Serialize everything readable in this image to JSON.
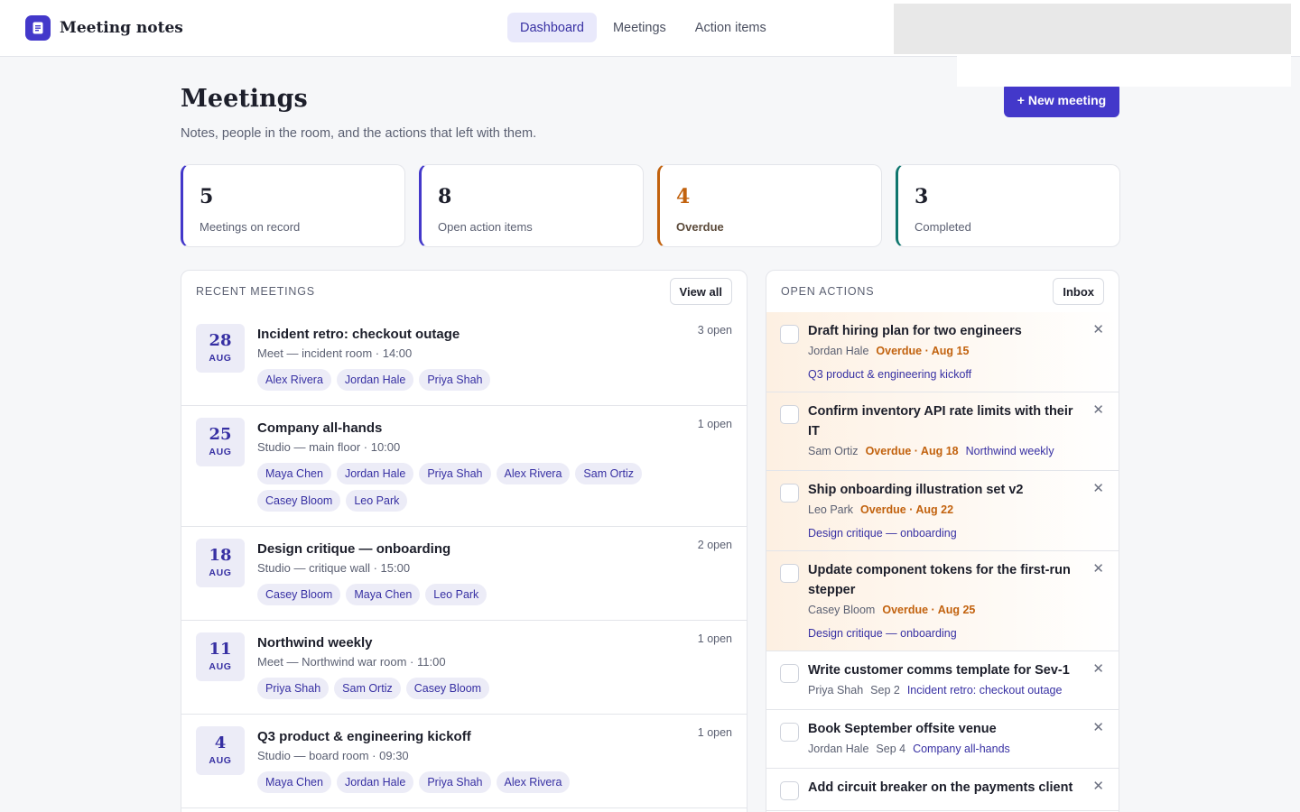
{
  "app": {
    "name": "Meeting notes"
  },
  "nav": {
    "tabs": [
      {
        "label": "Dashboard"
      },
      {
        "label": "Meetings"
      },
      {
        "label": "Action items"
      }
    ]
  },
  "header": {
    "title": "Meetings",
    "subtitle": "Notes, people in the room, and the actions that left with them.",
    "new_button": "+ New meeting"
  },
  "stats": [
    {
      "value": "5",
      "label": "Meetings on record"
    },
    {
      "value": "8",
      "label": "Open action items"
    },
    {
      "value": "4",
      "label": "Overdue"
    },
    {
      "value": "3",
      "label": "Completed"
    }
  ],
  "recent": {
    "title": "RECENT MEETINGS",
    "button": "View all",
    "meetings": [
      {
        "day": "28",
        "month": "AUG",
        "title": "Incident retro: checkout outage",
        "meta": "Meet — incident room · 14:00",
        "open": "3 open",
        "people": [
          "Alex Rivera",
          "Jordan Hale",
          "Priya Shah"
        ]
      },
      {
        "day": "25",
        "month": "AUG",
        "title": "Company all-hands",
        "meta": "Studio — main floor · 10:00",
        "open": "1 open",
        "people": [
          "Maya Chen",
          "Jordan Hale",
          "Priya Shah",
          "Alex Rivera",
          "Sam Ortiz",
          "Casey Bloom",
          "Leo Park"
        ]
      },
      {
        "day": "18",
        "month": "AUG",
        "title": "Design critique — onboarding",
        "meta": "Studio — critique wall · 15:00",
        "open": "2 open",
        "people": [
          "Casey Bloom",
          "Maya Chen",
          "Leo Park"
        ]
      },
      {
        "day": "11",
        "month": "AUG",
        "title": "Northwind weekly",
        "meta": "Meet — Northwind war room · 11:00",
        "open": "1 open",
        "people": [
          "Priya Shah",
          "Sam Ortiz",
          "Casey Bloom"
        ]
      },
      {
        "day": "4",
        "month": "AUG",
        "title": "Q3 product & engineering kickoff",
        "meta": "Studio — board room · 09:30",
        "open": "1 open",
        "people": [
          "Maya Chen",
          "Jordan Hale",
          "Priya Shah",
          "Alex Rivera"
        ]
      }
    ]
  },
  "actions": {
    "title": "OPEN ACTIONS",
    "button": "Inbox",
    "items": [
      {
        "title": "Draft hiring plan for two engineers",
        "owner": "Jordan Hale",
        "due": "Overdue · Aug 15",
        "overdue": true,
        "meeting": "Q3 product & engineering kickoff",
        "meeting_wrap": true
      },
      {
        "title": "Confirm inventory API rate limits with their IT",
        "owner": "Sam Ortiz",
        "due": "Overdue · Aug 18",
        "overdue": true,
        "meeting": "Northwind weekly",
        "meeting_wrap": false
      },
      {
        "title": "Ship onboarding illustration set v2",
        "owner": "Leo Park",
        "due": "Overdue · Aug 22",
        "overdue": true,
        "meeting": "Design critique — onboarding",
        "meeting_wrap": true
      },
      {
        "title": "Update component tokens for the first-run stepper",
        "owner": "Casey Bloom",
        "due": "Overdue · Aug 25",
        "overdue": true,
        "meeting": "Design critique — onboarding",
        "meeting_wrap": true
      },
      {
        "title": "Write customer comms template for Sev-1",
        "owner": "Priya Shah",
        "due": "Sep 2",
        "overdue": false,
        "meeting": "Incident retro: checkout outage",
        "meeting_wrap": false
      },
      {
        "title": "Book September offsite venue",
        "owner": "Jordan Hale",
        "due": "Sep 4",
        "overdue": false,
        "meeting": "Company all-hands",
        "meeting_wrap": false
      },
      {
        "title": "Add circuit breaker on the payments client",
        "owner": "",
        "due": "",
        "overdue": false,
        "meeting": "",
        "meeting_wrap": false
      }
    ]
  },
  "icons": {
    "logo": "notes-icon",
    "close": "close-icon"
  },
  "colors": {
    "accent": "#4338ca",
    "overdue": "#c2620e",
    "completed": "#0f766e"
  }
}
